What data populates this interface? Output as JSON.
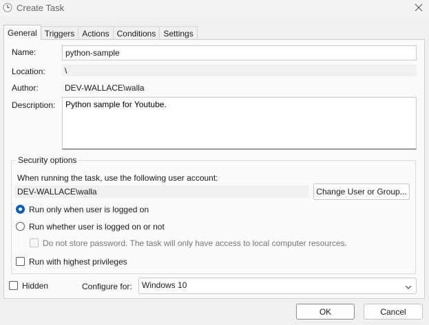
{
  "window": {
    "title": "Create Task",
    "icon": "clock-icon"
  },
  "tabs": [
    {
      "label": "General",
      "active": true
    },
    {
      "label": "Triggers"
    },
    {
      "label": "Actions"
    },
    {
      "label": "Conditions"
    },
    {
      "label": "Settings"
    }
  ],
  "general": {
    "name_label": "Name:",
    "name_value": "python-sample",
    "location_label": "Location:",
    "location_value": "\\",
    "author_label": "Author:",
    "author_value": "DEV-WALLACE\\walla",
    "description_label": "Description:",
    "description_value": "Python sample for Youtube."
  },
  "security": {
    "group_title": "Security options",
    "account_prompt": "When running the task, use the following user account:",
    "account_value": "DEV-WALLACE\\walla",
    "change_button": "Change User or Group...",
    "radio_logged_on": "Run only when user is logged on",
    "radio_logged_on_checked": true,
    "radio_whether": "Run whether user is logged on or not",
    "radio_whether_checked": false,
    "no_store_password": "Do not store password.  The task will only have access to local computer resources.",
    "highest_privileges": "Run with highest privileges"
  },
  "bottom": {
    "hidden_label": "Hidden",
    "configure_label": "Configure for:",
    "configure_value": "Windows 10"
  },
  "buttons": {
    "ok": "OK",
    "cancel": "Cancel"
  },
  "colors": {
    "accent": "#0a5cc4",
    "window_bg": "#f0f0f0",
    "panel_bg": "#fafafa"
  }
}
